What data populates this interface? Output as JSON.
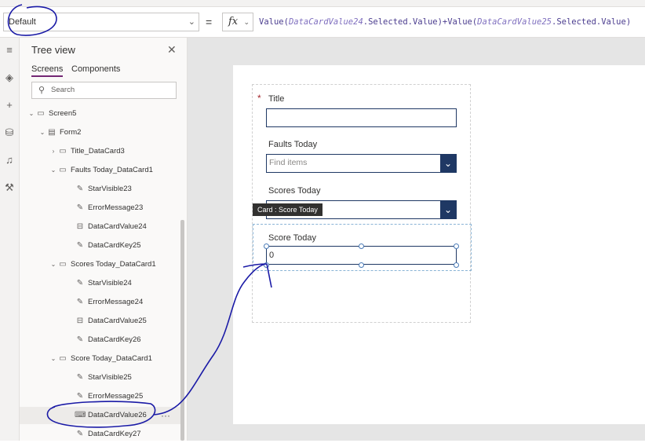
{
  "formula_bar": {
    "property": "Default",
    "equals": "=",
    "fx": "fx",
    "formula_parts": [
      "Value(",
      "DataCardValue24",
      ".Selected.Value)+Value(",
      "DataCardValue25",
      ".Selected.Value)"
    ]
  },
  "tree_view": {
    "title": "Tree view",
    "tabs": [
      "Screens",
      "Components"
    ],
    "active_tab": "Screens",
    "search_placeholder": "Search",
    "nodes": [
      {
        "label": "Screen5",
        "icon": "screen-icon",
        "depth": 0,
        "expanded": true
      },
      {
        "label": "Form2",
        "icon": "form-icon",
        "depth": 1,
        "expanded": true
      },
      {
        "label": "Title_DataCard3",
        "icon": "datacard-icon",
        "depth": 2,
        "expanded": false
      },
      {
        "label": "Faults Today_DataCard1",
        "icon": "datacard-icon",
        "depth": 2,
        "expanded": true
      },
      {
        "label": "StarVisible23",
        "icon": "label-icon",
        "depth": 3
      },
      {
        "label": "ErrorMessage23",
        "icon": "label-icon",
        "depth": 3
      },
      {
        "label": "DataCardValue24",
        "icon": "combobox-icon",
        "depth": 3
      },
      {
        "label": "DataCardKey25",
        "icon": "label-icon",
        "depth": 3
      },
      {
        "label": "Scores Today_DataCard1",
        "icon": "datacard-icon",
        "depth": 2,
        "expanded": true
      },
      {
        "label": "StarVisible24",
        "icon": "label-icon",
        "depth": 3
      },
      {
        "label": "ErrorMessage24",
        "icon": "label-icon",
        "depth": 3
      },
      {
        "label": "DataCardValue25",
        "icon": "combobox-icon",
        "depth": 3
      },
      {
        "label": "DataCardKey26",
        "icon": "label-icon",
        "depth": 3
      },
      {
        "label": "Score Today_DataCard1",
        "icon": "datacard-icon",
        "depth": 2,
        "expanded": true
      },
      {
        "label": "StarVisible25",
        "icon": "label-icon",
        "depth": 3
      },
      {
        "label": "ErrorMessage25",
        "icon": "label-icon",
        "depth": 3
      },
      {
        "label": "DataCardValue26",
        "icon": "textinput-icon",
        "depth": 3,
        "selected": true
      },
      {
        "label": "DataCardKey27",
        "icon": "label-icon",
        "depth": 3
      }
    ],
    "more_label": "···"
  },
  "form": {
    "required_marker": "*",
    "title_label": "Title",
    "faults_label": "Faults Today",
    "faults_placeholder": "Find items",
    "scores_label": "Scores Today",
    "tooltip": "Card : Score Today",
    "score_label": "Score Today",
    "score_value": "0"
  },
  "colors": {
    "annotation_ink": "#1a1aa6",
    "accent": "#742774",
    "control_border": "#1f3864"
  }
}
